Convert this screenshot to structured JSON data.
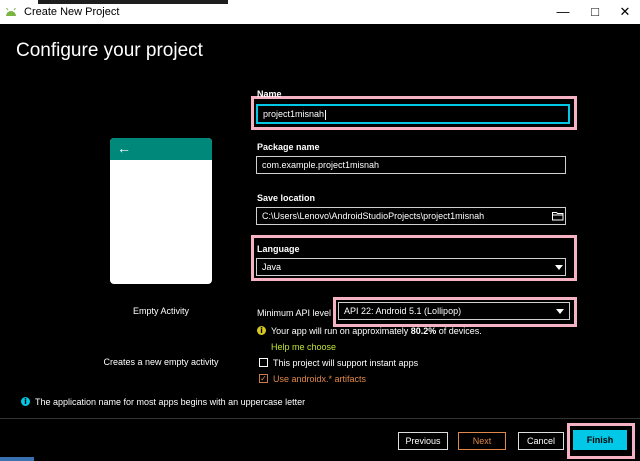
{
  "window": {
    "title": "Create New Project"
  },
  "page": {
    "heading": "Configure your project"
  },
  "template": {
    "name": "Empty Activity",
    "description": "Creates a new empty activity"
  },
  "form": {
    "name_label": "Name",
    "name_value": "project1misnah",
    "package_label": "Package name",
    "package_value": "com.example.project1misnah",
    "save_label": "Save location",
    "save_value": "C:\\Users\\Lenovo\\AndroidStudioProjects\\project1misnah",
    "language_label": "Language",
    "language_value": "Java",
    "api_label": "Minimum API level",
    "api_value": "API 22: Android 5.1 (Lollipop)",
    "api_info_prefix": "Your app will run on approximately ",
    "api_info_percent": "80.2%",
    "api_info_suffix": " of devices.",
    "help_link": "Help me choose",
    "instant_apps_label": "This project will support instant apps",
    "androidx_label": "Use androidx.* artifacts",
    "instant_apps_checked": false,
    "androidx_checked": true
  },
  "footer": {
    "note": "The application name for most apps begins with an uppercase letter",
    "previous": "Previous",
    "next": "Next",
    "cancel": "Cancel",
    "finish": "Finish"
  },
  "colors": {
    "accent": "#00c8e6",
    "highlight": "#f4b2c2",
    "link": "#c0e030",
    "next": "#e0884a",
    "toolbar": "#00897b",
    "info": "#d8c822"
  },
  "icons": {
    "folder": "folder-icon",
    "back_arrow": "back-arrow-icon",
    "info": "info-icon"
  }
}
